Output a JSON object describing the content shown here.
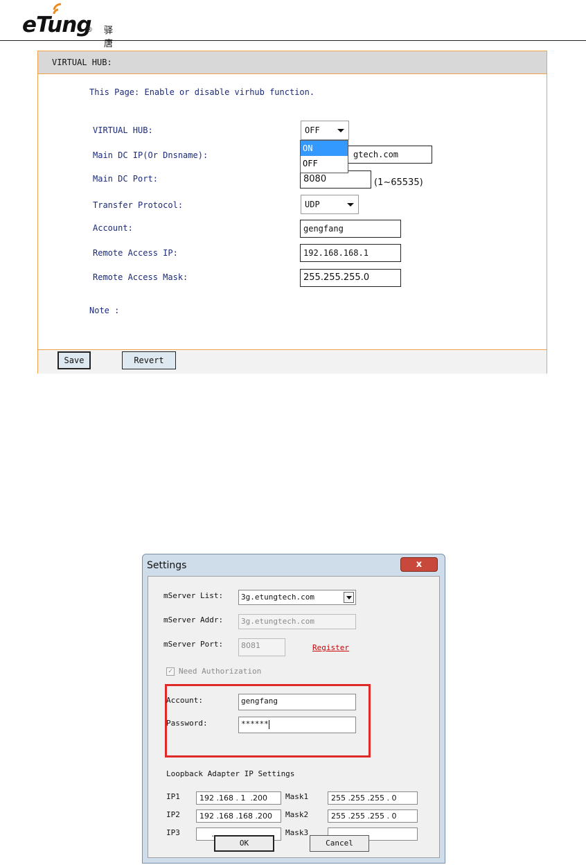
{
  "header": {
    "logo_text": "eTung",
    "logo_mark": "®",
    "company_cn": "驿唐科技"
  },
  "virtual_hub_panel": {
    "title": "VIRTUAL HUB:",
    "description": "This Page: Enable or disable virhub function.",
    "fields": {
      "virtual_hub": {
        "label": "VIRTUAL HUB:",
        "value": "OFF",
        "options": [
          "ON",
          "OFF"
        ],
        "highlighted_option": "ON"
      },
      "main_dc_ip": {
        "label": "Main DC IP(Or Dnsname):",
        "value": "gtech.com"
      },
      "main_dc_port": {
        "label": "Main DC Port:",
        "value": "8080",
        "range_hint": "(1~65535)"
      },
      "transfer_protocol": {
        "label": "Transfer Protocol:",
        "value": "UDP"
      },
      "account": {
        "label": "Account:",
        "value": "gengfang"
      },
      "remote_access_ip": {
        "label": "Remote Access IP:",
        "value": "192.168.168.1"
      },
      "remote_access_mask": {
        "label": "Remote Access Mask:",
        "value": "255.255.255.0"
      }
    },
    "note_label": "Note :",
    "buttons": {
      "save": "Save",
      "revert": "Revert"
    }
  },
  "settings_dialog": {
    "title": "Settings",
    "close_glyph": "x",
    "mserver_list": {
      "label": "mServer List:",
      "value": "3g.etungtech.com"
    },
    "mserver_addr": {
      "label": "mServer Addr:",
      "value": "3g.etungtech.com"
    },
    "mserver_port": {
      "label": "mServer Port:",
      "value": "8081"
    },
    "register_link": "Register",
    "need_authorization": {
      "label": "Need Authorization",
      "checked": true,
      "check_glyph": "✓"
    },
    "account": {
      "label": "Account:",
      "value": "gengfang"
    },
    "password": {
      "label": "Password:",
      "value": "******"
    },
    "loopback_heading": "Loopback Adapter IP Settings",
    "ip_rows": [
      {
        "ip_label": "IP1",
        "ip_value": "192 .168 . 1  .200",
        "mask_label": "Mask1",
        "mask_value": "255 .255 .255 . 0"
      },
      {
        "ip_label": "IP2",
        "ip_value": "192 .168 .168 .200",
        "mask_label": "Mask2",
        "mask_value": "255 .255 .255 . 0"
      },
      {
        "ip_label": "IP3",
        "ip_value": "     .    .    .",
        "mask_label": "Mask3",
        "mask_value": "     .    .    ."
      }
    ],
    "ok_label": "OK",
    "cancel_label": "Cancel"
  },
  "colors": {
    "panel_border": "#f0a24a",
    "panel_text": "#1c2a7a",
    "dropdown_highlight": "#3399ff",
    "register_link": "#cc0000",
    "annotation_box": "#e02a2a",
    "close_button": "#c8493b"
  }
}
